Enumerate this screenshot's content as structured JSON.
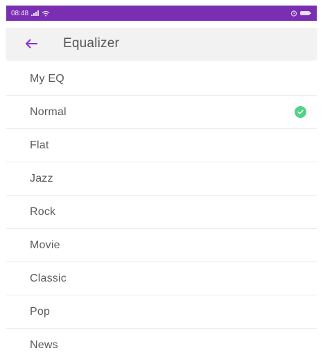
{
  "status_bar": {
    "time": "08:48",
    "signal_icon": "signal-icon",
    "wifi_icon": "wifi-icon",
    "alarm_icon": "alarm-icon",
    "battery_icon": "battery-icon",
    "background_color": "#7a2fb3"
  },
  "app_bar": {
    "title": "Equalizer",
    "back_icon": "arrow-left-icon",
    "accent_color": "#8e2bd9"
  },
  "presets": [
    {
      "label": "My EQ",
      "selected": false
    },
    {
      "label": "Normal",
      "selected": true
    },
    {
      "label": "Flat",
      "selected": false
    },
    {
      "label": "Jazz",
      "selected": false
    },
    {
      "label": "Rock",
      "selected": false
    },
    {
      "label": "Movie",
      "selected": false
    },
    {
      "label": "Classic",
      "selected": false
    },
    {
      "label": "Pop",
      "selected": false
    },
    {
      "label": "News",
      "selected": false
    }
  ],
  "selected_indicator": {
    "icon": "check-circle-icon",
    "color": "#53d18a"
  }
}
